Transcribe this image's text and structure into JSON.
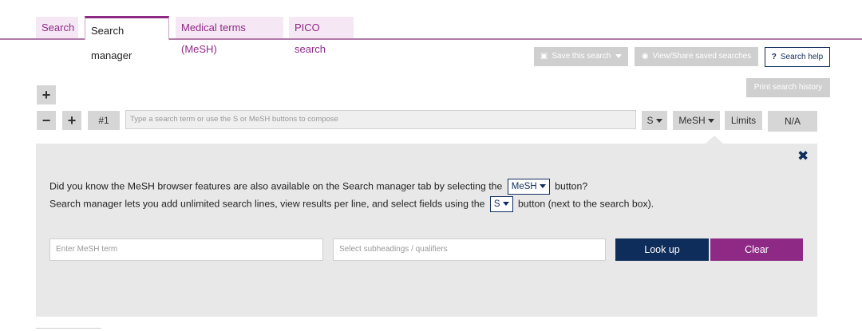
{
  "tabs": [
    {
      "label": "Search"
    },
    {
      "label": "Search manager"
    },
    {
      "label": "Medical terms (MeSH)"
    },
    {
      "label": "PICO search"
    }
  ],
  "actions": {
    "save_search": "Save this search",
    "view_share": "View/Share saved searches",
    "search_help": "Search help",
    "print_history": "Print search history"
  },
  "search_line": {
    "add_symbol": "+",
    "remove_symbol": "−",
    "line_number": "#1",
    "placeholder": "Type a search term or use the S or MeSH buttons to compose",
    "s_button": "S",
    "mesh_button": "MeSH",
    "limits_button": "Limits",
    "result_count": "N/A"
  },
  "panel": {
    "close_symbol": "✖",
    "line1_before": "Did you know the MeSH browser features are also available on the Search manager tab by selecting the",
    "line1_button": "MeSH",
    "line1_after": "button?",
    "line2_before": "Search manager lets you add unlimited search lines, view results per line, and select fields using the",
    "line2_button": "S",
    "line2_after": "button (next to the search box).",
    "mesh_term_placeholder": "Enter MeSH term",
    "subheadings_placeholder": "Select subheadings / qualifiers",
    "lookup_button": "Look up",
    "clear_button": "Clear"
  },
  "icons": {
    "save": "save-icon",
    "eye": "eye-icon",
    "help": "question-icon",
    "close": "close-icon"
  },
  "colors": {
    "brand_purple": "#8e2a86",
    "navy": "#0f2d5a",
    "panel_grey": "#e8e8e8"
  }
}
